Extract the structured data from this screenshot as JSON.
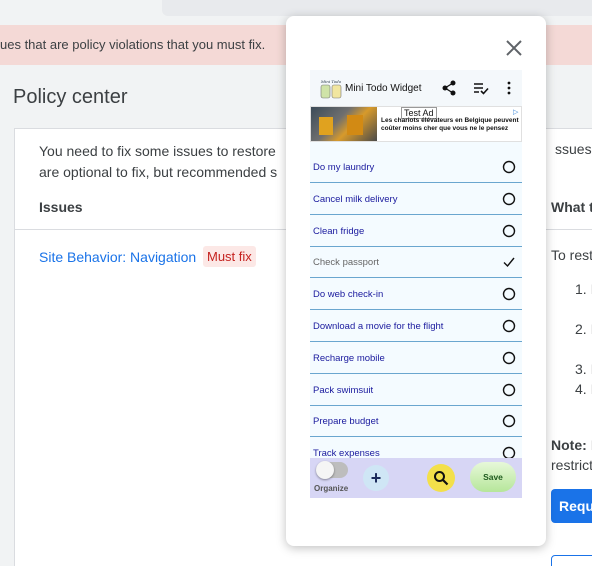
{
  "background": {
    "banner_text": "ues that are policy violations that you must fix.",
    "page_title": "Policy center",
    "intro_line1": "You need to fix some issues to restore",
    "intro_line1_right": "ssues a",
    "intro_line2": "are optional to fix, but recommended s",
    "issues_header": "Issues",
    "right_header": "What t",
    "issue_link": "Site Behavior: Navigation",
    "issue_badge": "Must fix",
    "restore_text": "To rest",
    "steps": [
      "1. I",
      "2. I",
      "3. I",
      "4. I"
    ],
    "note_label": "Note:",
    "note_rest": " I",
    "note_line2": "restrict",
    "request_button": "Requ"
  },
  "modal": {
    "app_title": "Mini Todo Widget",
    "logo_text": "Mini Todo Widget",
    "ad": {
      "label": "Test Ad",
      "text": "Les chariots élévateurs en Belgique peuvent coûter moins cher que vous ne le pensez"
    },
    "items": [
      {
        "label": "Do my laundry",
        "done": false
      },
      {
        "label": "Cancel milk delivery",
        "done": false
      },
      {
        "label": "Clean fridge",
        "done": false
      },
      {
        "label": "Check passport",
        "done": true
      },
      {
        "label": "Do web check-in",
        "done": false
      },
      {
        "label": "Download a movie for the flight",
        "done": false
      },
      {
        "label": "Recharge mobile",
        "done": false
      },
      {
        "label": "Pack swimsuit",
        "done": false
      },
      {
        "label": "Prepare budget",
        "done": false
      },
      {
        "label": "Track expenses",
        "done": false
      }
    ],
    "footer": {
      "organize_label": "Organize",
      "plus_label": "+",
      "save_label": "Save"
    }
  },
  "colors": {
    "link": "#1a73e8",
    "badge_text": "#c5221f",
    "banner_bg": "#f4d9d6",
    "item_text": "#1a1a9e",
    "item_border": "#6aa6cf",
    "footer_bg": "#d7d6f5"
  }
}
